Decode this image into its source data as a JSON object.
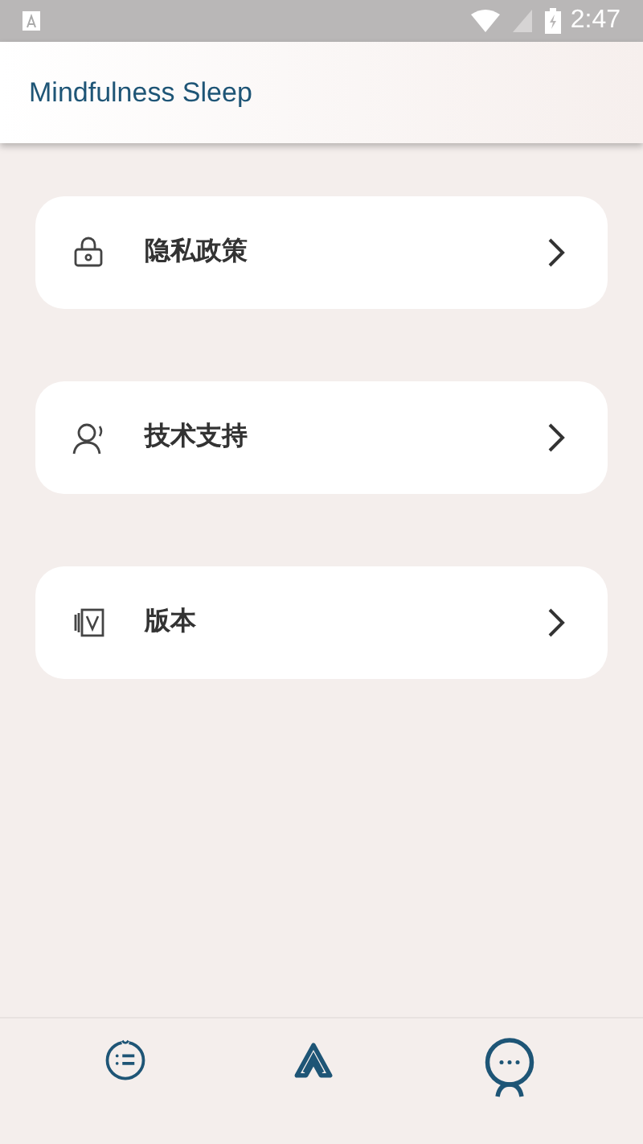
{
  "status_bar": {
    "time": "2:47"
  },
  "app_bar": {
    "title": "Mindfulness Sleep"
  },
  "menu_items": [
    {
      "kind": "lock",
      "label": "隐私政策"
    },
    {
      "kind": "person",
      "label": "技术支持"
    },
    {
      "kind": "version",
      "label": "版本"
    }
  ],
  "bottom_nav": [
    {
      "kind": "list",
      "selected": false
    },
    {
      "kind": "triangle",
      "selected": false
    },
    {
      "kind": "chat",
      "selected": true
    }
  ]
}
